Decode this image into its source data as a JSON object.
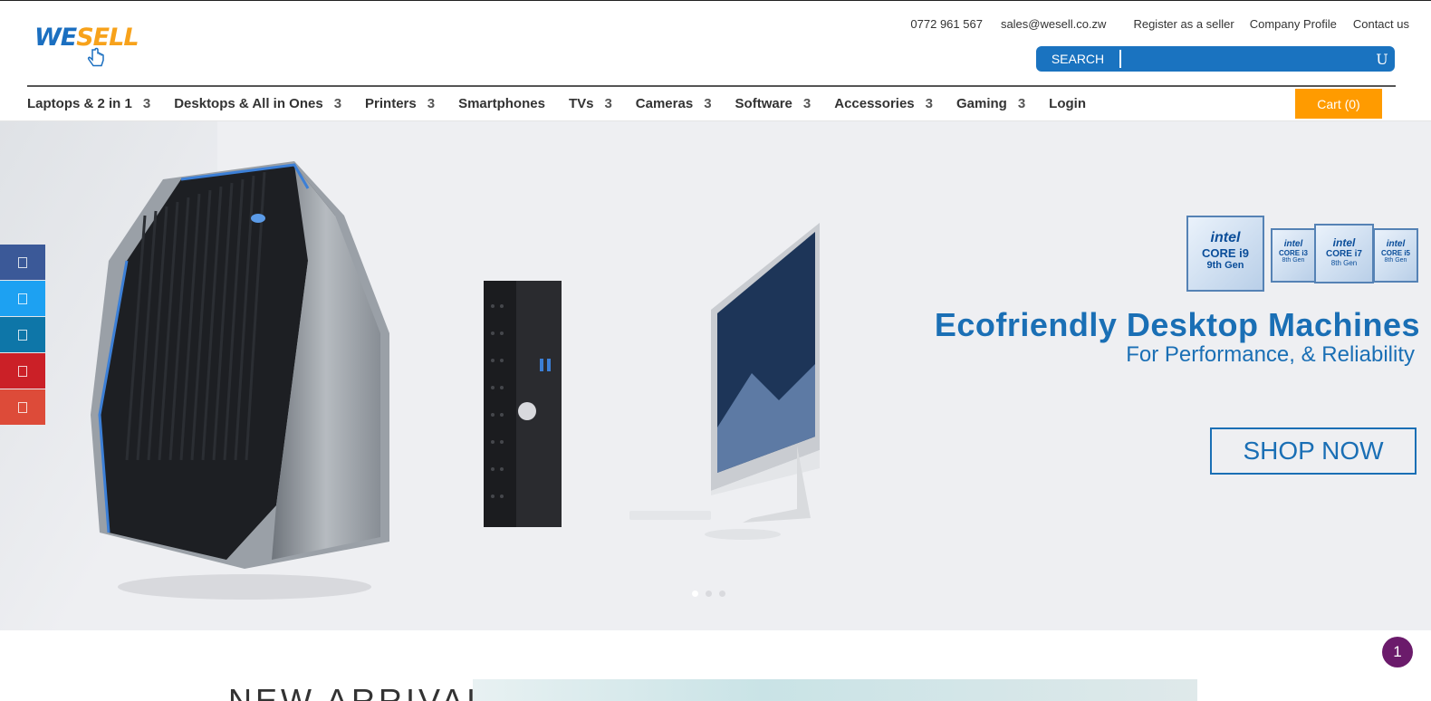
{
  "brand": {
    "logo_we": "WE",
    "logo_sell": "SELL",
    "color_blue": "#1b6fc0",
    "color_orange": "#f7a21b"
  },
  "toplinks": {
    "phone": "0772 961 567",
    "email": "sales@wesell.co.zw",
    "register": "Register as a seller",
    "profile": "Company Profile",
    "contact": "Contact us"
  },
  "search": {
    "label": "SEARCH",
    "value": "",
    "button_glyph": "U"
  },
  "nav": {
    "items": [
      {
        "label": "Laptops & 2 in 1",
        "caret": "3"
      },
      {
        "label": "Desktops & All in Ones",
        "caret": "3"
      },
      {
        "label": "Printers",
        "caret": "3"
      },
      {
        "label": "Smartphones",
        "caret": ""
      },
      {
        "label": "TVs",
        "caret": "3"
      },
      {
        "label": "Cameras",
        "caret": "3"
      },
      {
        "label": "Software",
        "caret": "3"
      },
      {
        "label": "Accessories",
        "caret": "3"
      },
      {
        "label": "Gaming",
        "caret": "3"
      },
      {
        "label": "Login",
        "caret": ""
      }
    ],
    "cart": "Cart (0)"
  },
  "hero": {
    "headline": "Ecofriendly Desktop Machines",
    "subheadline": "For Performance, & Reliability",
    "cta": "SHOP NOW",
    "intel_badges": [
      {
        "brand": "intel",
        "line1": "CORE i9",
        "line2": "9th Gen"
      },
      {
        "brand": "intel",
        "line1": "CORE i3",
        "line2": "8th Gen"
      },
      {
        "brand": "intel",
        "line1": "CORE i7",
        "line2": "8th Gen"
      },
      {
        "brand": "intel",
        "line1": "CORE i5",
        "line2": "8th Gen"
      }
    ],
    "slides": 3,
    "active_slide": 1
  },
  "social": [
    {
      "name": "facebook",
      "color": "#3b5998"
    },
    {
      "name": "twitter",
      "color": "#1da1f2"
    },
    {
      "name": "linkedin",
      "color": "#0e76a8"
    },
    {
      "name": "pinterest",
      "color": "#cb2027"
    },
    {
      "name": "google-plus",
      "color": "#dd4b39"
    }
  ],
  "notification_badge": "1",
  "section": {
    "title": "NEW ARRIVALS"
  }
}
